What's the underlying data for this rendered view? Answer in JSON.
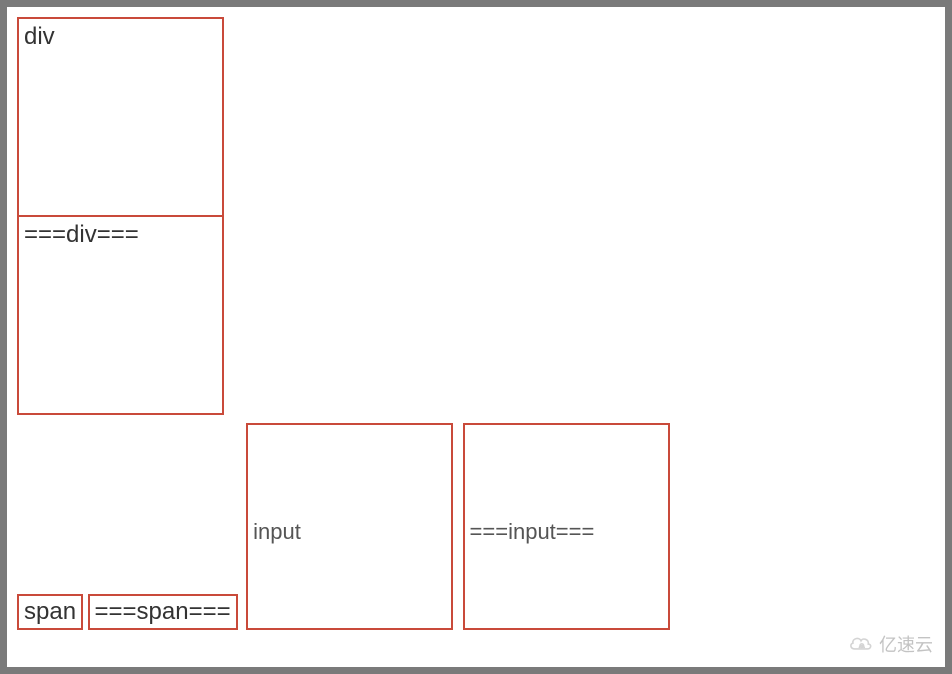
{
  "boxes": {
    "div1_label": "div",
    "div2_label": "===div===",
    "span1_label": "span",
    "span2_label": "===span===",
    "input1_label": "input",
    "input2_label": "===input==="
  },
  "watermark": {
    "text": "亿速云"
  }
}
